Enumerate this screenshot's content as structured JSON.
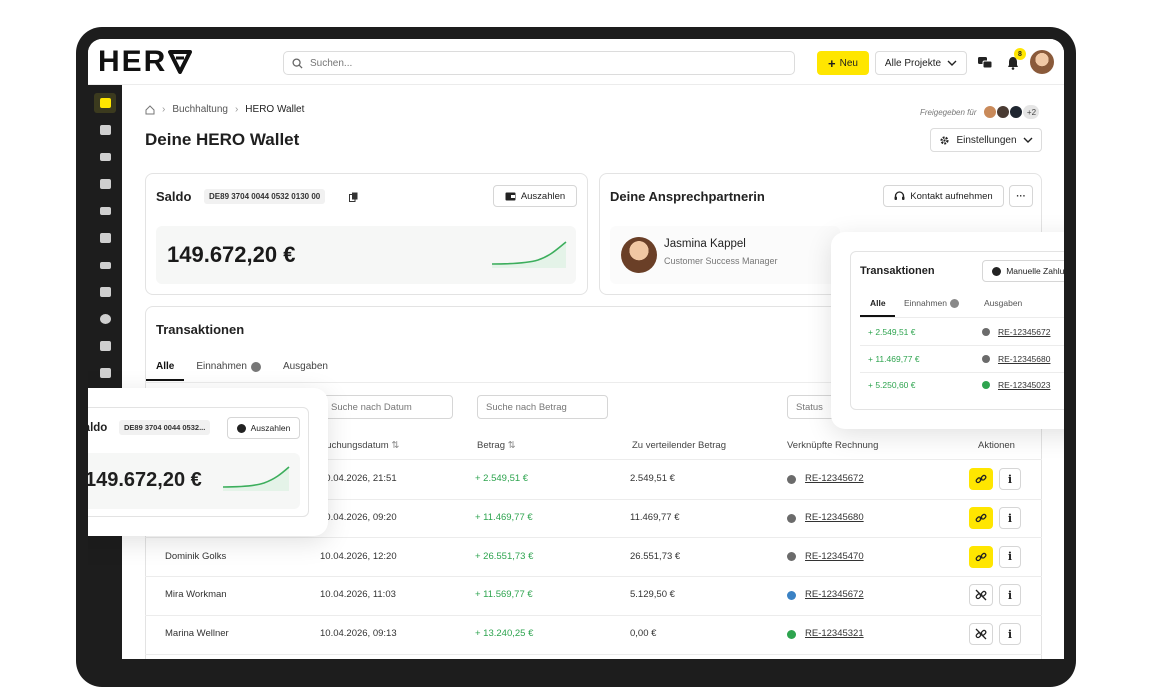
{
  "app": {
    "logo": "HER"
  },
  "search": {
    "placeholder": "Suchen..."
  },
  "topbar": {
    "new_label": "Neu",
    "projects_label": "Alle Projekte",
    "notif_count": "8"
  },
  "breadcrumb": {
    "section": "Buchhaltung",
    "page": "HERO Wallet"
  },
  "page_title": "Deine HERO Wallet",
  "shared": {
    "label": "Freigegeben für",
    "extra": "+2"
  },
  "settings_label": "Einstellungen",
  "saldo": {
    "title": "Saldo",
    "iban": "DE89 3704 0044 0532 0130 00",
    "payout_label": "Auszahlen",
    "balance": "149.672,20 €"
  },
  "contact": {
    "title": "Deine Ansprechpartnerin",
    "action_label": "Kontakt aufnehmen",
    "more_label": "···",
    "name": "Jasmina Kappel",
    "role": "Customer Success Manager"
  },
  "transactions": {
    "title": "Transaktionen",
    "tabs": [
      "Alle",
      "Einnahmen",
      "Ausgaben"
    ],
    "filters": {
      "date": "Suche nach Datum",
      "amount": "Suche nach Betrag",
      "status": "Status"
    },
    "columns": [
      "Buchungsdatum",
      "Betrag",
      "Zu verteilender Betrag",
      "Verknüpfte Rechnung",
      "Aktionen"
    ],
    "rows": [
      {
        "name": "",
        "date": "10.04.2026, 21:51",
        "amount": "+ 2.549,51 €",
        "distribute": "2.549,51 €",
        "invoice": "RE-12345672",
        "status": "grey",
        "linked": true
      },
      {
        "name": "",
        "date": "10.04.2026, 09:20",
        "amount": "+ 11.469,77 €",
        "distribute": "11.469,77 €",
        "invoice": "RE-12345680",
        "status": "grey",
        "linked": true
      },
      {
        "name": "Dominik Golks",
        "date": "10.04.2026, 12:20",
        "amount": "+ 26.551,73 €",
        "distribute": "26.551,73 €",
        "invoice": "RE-12345470",
        "status": "grey",
        "linked": true
      },
      {
        "name": "Mira Workman",
        "date": "10.04.2026, 11:03",
        "amount": "+ 11.569,77 €",
        "distribute": "5.129,50 €",
        "invoice": "RE-12345672",
        "status": "half",
        "linked": false
      },
      {
        "name": "Marina Wellner",
        "date": "10.04.2026, 09:13",
        "amount": "+ 13.240,25 €",
        "distribute": "0,00 €",
        "invoice": "RE-12345321",
        "status": "green",
        "linked": false
      }
    ]
  },
  "float_saldo": {
    "title": "Saldo",
    "iban": "DE89 3704 0044 0532...",
    "payout_label": "Auszahlen",
    "balance": "149.672,20 €"
  },
  "float_tx": {
    "title": "Transaktionen",
    "action_label": "Manuelle Zahlung",
    "tabs": [
      "Alle",
      "Einnahmen",
      "Ausgaben"
    ],
    "rows": [
      {
        "amount": "+ 2.549,51 €",
        "invoice": "RE-12345672",
        "status": "grey"
      },
      {
        "amount": "+ 11.469,77 €",
        "invoice": "RE-12345680",
        "status": "grey"
      },
      {
        "amount": "+ 5.250,60 €",
        "invoice": "RE-12345023",
        "status": "green"
      }
    ]
  },
  "chart_data": {
    "type": "line",
    "note_series": [
      0,
      0,
      1,
      2,
      4,
      10
    ]
  },
  "colors": {
    "accent": "#ffe600",
    "positive": "#2ea44f",
    "sidebar": "#1d1d1d"
  }
}
